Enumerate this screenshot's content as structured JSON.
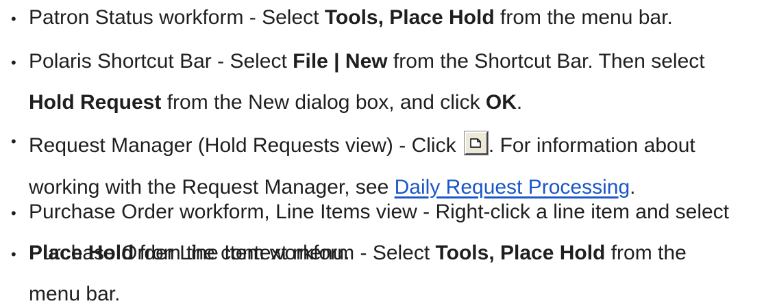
{
  "items": [
    {
      "lines": [
        [
          {
            "t": "Patron Status workform - Select ",
            "s": "n"
          },
          {
            "t": "Tools, Place Hold",
            "s": "b"
          },
          {
            "t": " from the menu bar.",
            "s": "n"
          }
        ]
      ]
    },
    {
      "lines": [
        [
          {
            "t": "Polaris Shortcut Bar - Select ",
            "s": "n"
          },
          {
            "t": "File | New",
            "s": "b"
          },
          {
            "t": " from the Shortcut Bar. Then select",
            "s": "n"
          }
        ],
        [
          {
            "t": "Hold Request",
            "s": "b"
          },
          {
            "t": " from the New dialog box, and click ",
            "s": "n"
          },
          {
            "t": "OK",
            "s": "b"
          },
          {
            "t": ".",
            "s": "n"
          }
        ]
      ]
    },
    {
      "raised_bullet": true,
      "lines": [
        [
          {
            "t": "Request Manager (Hold Requests view) - Click ",
            "s": "n"
          },
          {
            "t": "new-document-icon",
            "s": "icon"
          },
          {
            "t": ". For information about",
            "s": "n"
          }
        ],
        [
          {
            "t": "working with the Request Manager, see ",
            "s": "n"
          },
          {
            "t": "Daily Request Processing",
            "s": "link"
          },
          {
            "t": ".",
            "s": "n"
          }
        ]
      ]
    },
    {
      "lines": [
        [
          {
            "t": "Purchase Order workform, Line Items view - Right-click a line item and select",
            "s": "n"
          }
        ],
        [
          {
            "t": "Place Hold",
            "s": "b"
          },
          {
            "t": " from the context menu.",
            "s": "n"
          }
        ]
      ]
    },
    {
      "lines": [
        [
          {
            "t": "Purchase Order Line Item workform - Select ",
            "s": "n"
          },
          {
            "t": "Tools, Place Hold",
            "s": "b"
          },
          {
            "t": " from the",
            "s": "n"
          }
        ],
        [
          {
            "t": "menu bar.",
            "s": "n"
          }
        ]
      ]
    }
  ],
  "colors": {
    "text": "#1f1f1f",
    "link": "#1a56c8"
  },
  "bullet_glyph": "•"
}
